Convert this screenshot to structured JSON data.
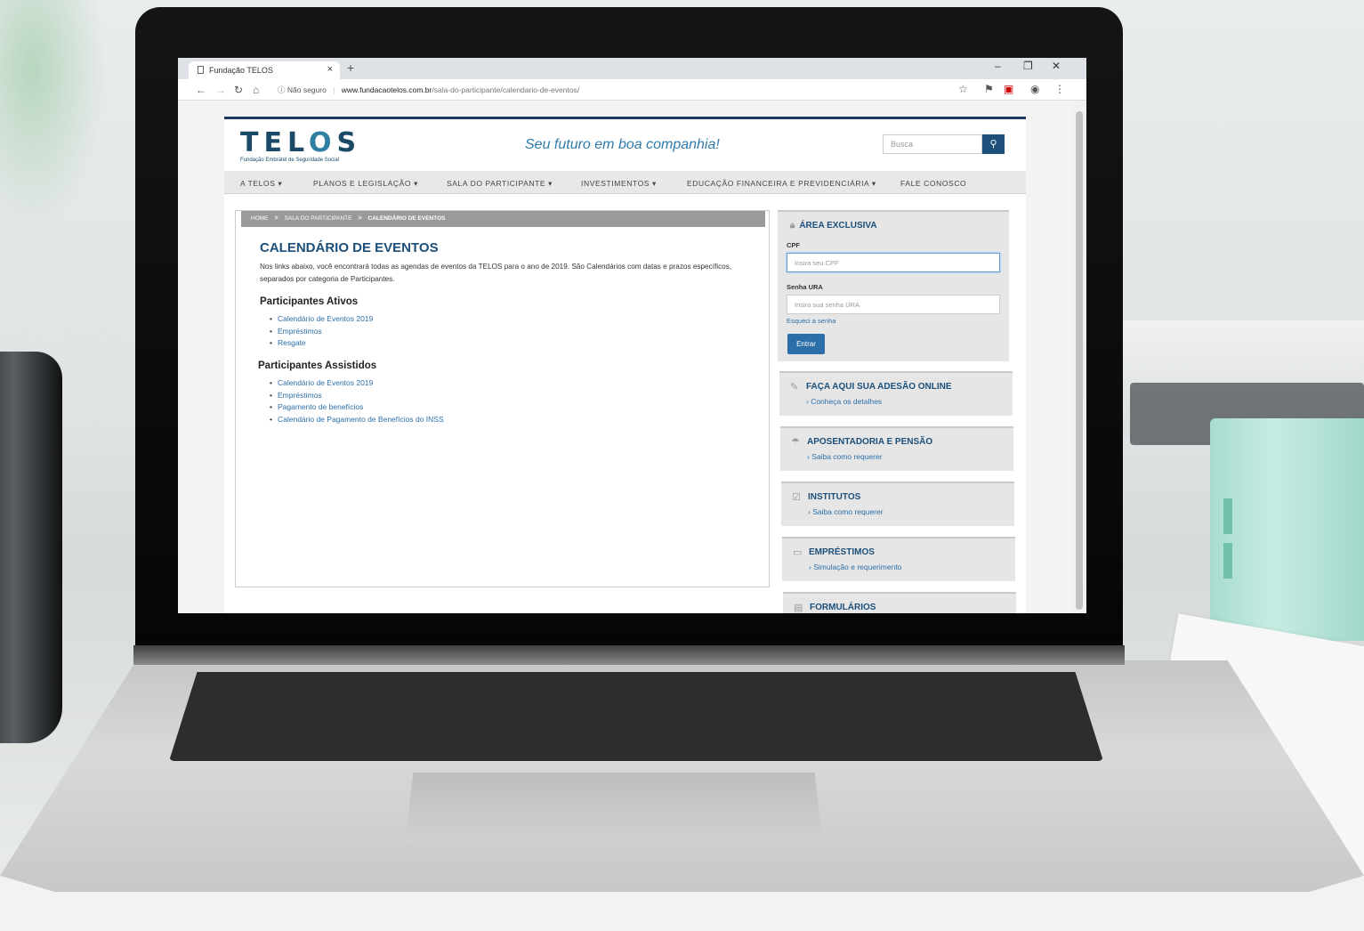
{
  "browser": {
    "tab_title": "Fundação TELOS",
    "tab_close": "×",
    "new_tab": "+",
    "security": "ⓘ Não seguro",
    "url_host": "www.fundacaotelos.com.br",
    "url_path": "/sala-do-participante/calendario-de-eventos/",
    "minimize": "–",
    "restore": "❐",
    "close": "✕"
  },
  "site": {
    "logo": "TELOS",
    "logo_subtitle": "Fundação Embratel de Seguridade Social",
    "tagline": "Seu futuro em boa companhia!",
    "search_placeholder": "Busca",
    "menu": [
      "A TELOS ▾",
      "PLANOS E LEGISLAÇÃO ▾",
      "SALA DO PARTICIPANTE ▾",
      "INVESTIMENTOS ▾",
      "EDUCAÇÃO FINANCEIRA E PREVIDENCIÁRIA ▾",
      "FALE CONOSCO"
    ]
  },
  "breadcrumb": {
    "home": "HOME",
    "sala": "SALA DO PARTICIPANTE",
    "current": "CALENDÁRIO DE EVENTOS",
    "sep": ">"
  },
  "main": {
    "title": "CALENDÁRIO DE EVENTOS",
    "intro": "Nos links abaixo, você encontrará todas as agendas de eventos da TELOS para o ano de 2019. São Calendários com datas e prazos específicos, separados por categoria de Participantes.",
    "ativos_heading": "Participantes Ativos",
    "ativos_links": [
      "Calendário de Eventos 2019",
      "Empréstimos",
      "Resgate"
    ],
    "assistidos_heading": "Participantes Assistidos",
    "assistidos_links": [
      "Calendário de Eventos 2019",
      "Empréstimos",
      "Pagamento de benefícios",
      "Calendário de Pagamento de Benefícios do INSS"
    ]
  },
  "login": {
    "title": "ÁREA EXCLUSIVA",
    "cpf_label": "CPF",
    "cpf_placeholder": "Insira seu CPF",
    "senha_label": "Senha URA",
    "senha_placeholder": "Insira sua senha URA",
    "forgot": "Esqueci a senha",
    "submit": "Entrar"
  },
  "promos": [
    {
      "title": "FAÇA AQUI SUA ADESÃO ONLINE",
      "link": "› Conheça os detalhes",
      "icon": "pencil-icon"
    },
    {
      "title": "APOSENTADORIA E PENSÃO",
      "link": "› Saiba como requerer",
      "icon": "umbrella-icon"
    },
    {
      "title": "INSTITUTOS",
      "link": "› Saiba como requerer",
      "icon": "checkbox-icon"
    },
    {
      "title": "EMPRÉSTIMOS",
      "link": "› Simulação e requerimento",
      "icon": "money-icon"
    },
    {
      "title": "FORMULÁRIOS",
      "link": "",
      "icon": "document-icon"
    }
  ]
}
